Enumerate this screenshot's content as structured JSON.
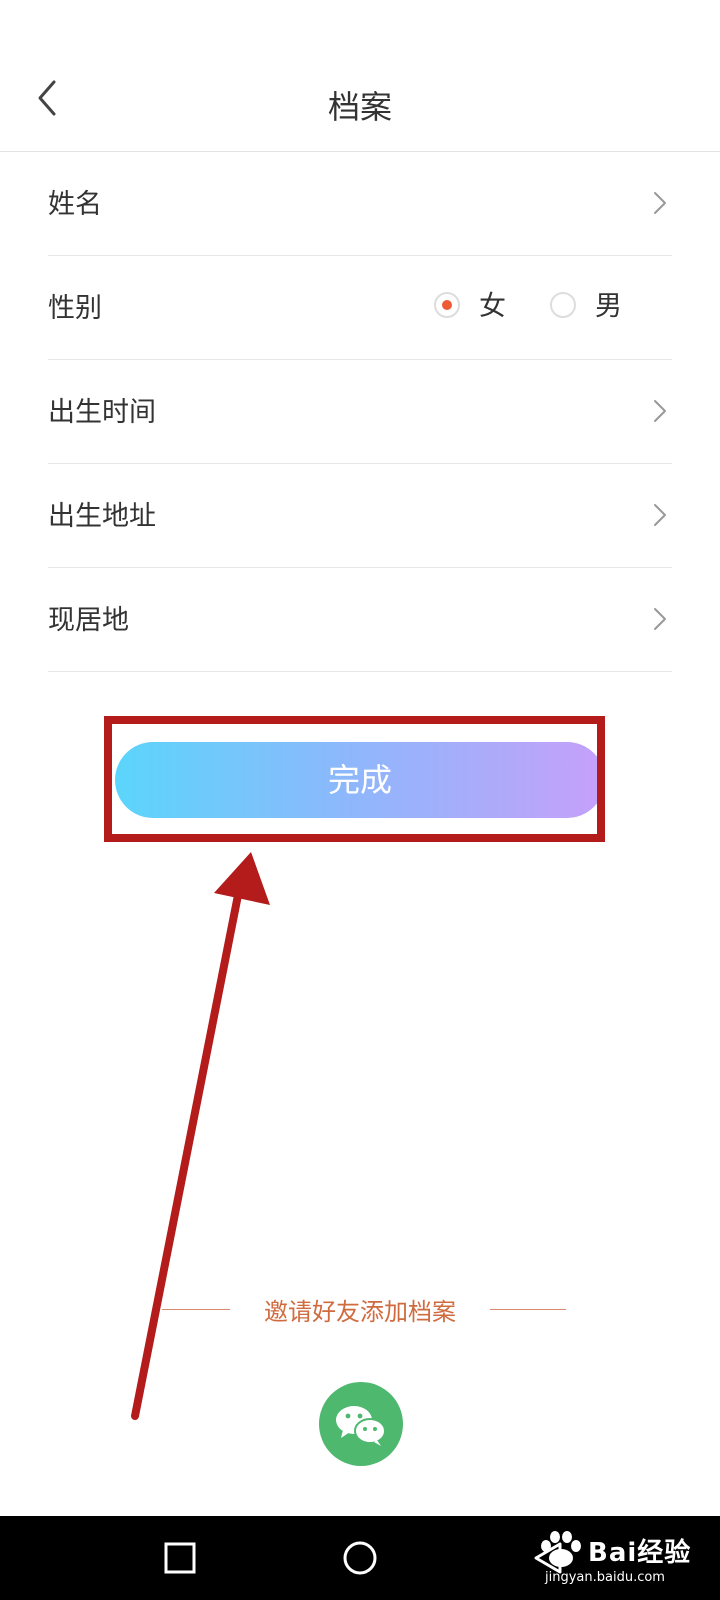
{
  "header": {
    "title": "档案",
    "back_icon": "chevron-left-icon"
  },
  "form": {
    "rows": [
      {
        "label": "姓名",
        "icon": "chevron-right-icon"
      },
      {
        "label": "性别"
      },
      {
        "label": "出生时间",
        "icon": "chevron-right-icon"
      },
      {
        "label": "出生地址",
        "icon": "chevron-right-icon"
      },
      {
        "label": "现居地",
        "icon": "chevron-right-icon"
      }
    ],
    "gender": {
      "options": [
        "女",
        "男"
      ],
      "selected": "女"
    }
  },
  "submit": {
    "label": "完成",
    "gradient": [
      "#5bd5fb",
      "#c6a0fa"
    ]
  },
  "invite": {
    "text": "邀请好友添加档案",
    "share_icon": "wechat-icon",
    "color": "#d06b3f",
    "wechat_color": "#4fb86f"
  },
  "annotation": {
    "color": "#b41b1b"
  },
  "nav": {
    "icons": [
      "square-icon",
      "circle-icon",
      "triangle-back-icon"
    ]
  },
  "watermark": {
    "logo": "Bai经验",
    "url": "jingyan.baidu.com"
  },
  "colors": {
    "accent": "#ee5a33",
    "divider": "#e6e6e6",
    "text": "#333333"
  }
}
